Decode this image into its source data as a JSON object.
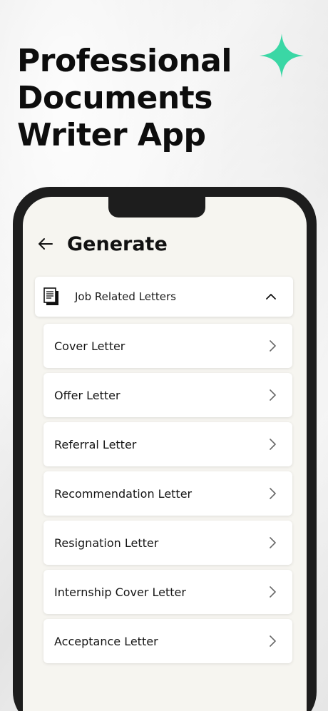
{
  "headline": [
    "Professional",
    "Documents",
    "Writer App"
  ],
  "colors": {
    "accent": "#3ad7a5",
    "frame": "#1d1d1d",
    "screen": "#f6f5f0"
  },
  "topbar": {
    "title": "Generate",
    "back_icon": "arrow-left-icon"
  },
  "category": {
    "label": "Job Related Letters",
    "icon": "document-icon",
    "expanded_icon": "chevron-up-icon"
  },
  "items": [
    {
      "label": "Cover Letter"
    },
    {
      "label": "Offer Letter"
    },
    {
      "label": "Referral Letter"
    },
    {
      "label": "Recommendation Letter"
    },
    {
      "label": "Resignation Letter"
    },
    {
      "label": "Internship Cover Letter"
    },
    {
      "label": "Acceptance Letter"
    }
  ]
}
